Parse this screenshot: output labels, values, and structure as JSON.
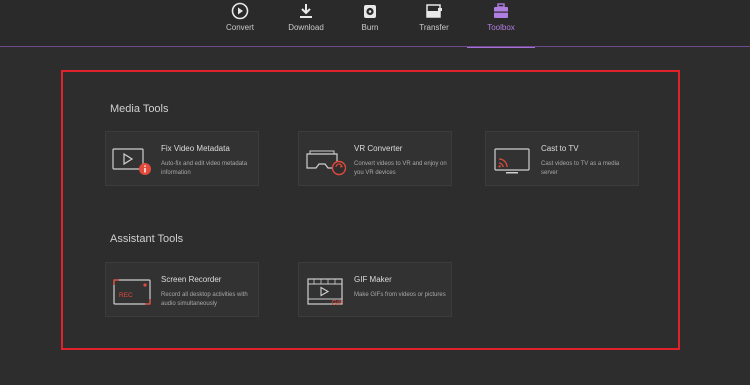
{
  "nav": {
    "tabs": [
      {
        "label": "Convert",
        "icon": "convert-icon"
      },
      {
        "label": "Download",
        "icon": "download-icon"
      },
      {
        "label": "Burn",
        "icon": "disc-icon"
      },
      {
        "label": "Transfer",
        "icon": "transfer-icon"
      },
      {
        "label": "Toolbox",
        "icon": "toolbox-icon",
        "active": true
      }
    ]
  },
  "colors": {
    "accent": "#a56ed8",
    "highlight": "#e0232b",
    "icon_red": "#e24b3b",
    "background": "#2e2d2e"
  },
  "media_tools": {
    "title": "Media Tools",
    "cards": [
      {
        "title": "Fix Video Metadata",
        "desc": "Auto-fix and edit video metadata information",
        "icon": "video-info-icon"
      },
      {
        "title": "VR Converter",
        "desc": "Convert videos to VR and enjoy on you VR devices",
        "icon": "vr-headset-icon"
      },
      {
        "title": "Cast to TV",
        "desc": "Cast videos to TV as a media server",
        "icon": "cast-tv-icon"
      }
    ]
  },
  "assistant_tools": {
    "title": "Assistant Tools",
    "cards": [
      {
        "title": "Screen Recorder",
        "desc": "Record all desktop activities with audio simultaneously",
        "icon": "screen-recorder-icon",
        "badge": "REC"
      },
      {
        "title": "GIF Maker",
        "desc": "Make GIFs from videos or pictures",
        "icon": "gif-maker-icon",
        "badge": "GIF"
      }
    ]
  }
}
